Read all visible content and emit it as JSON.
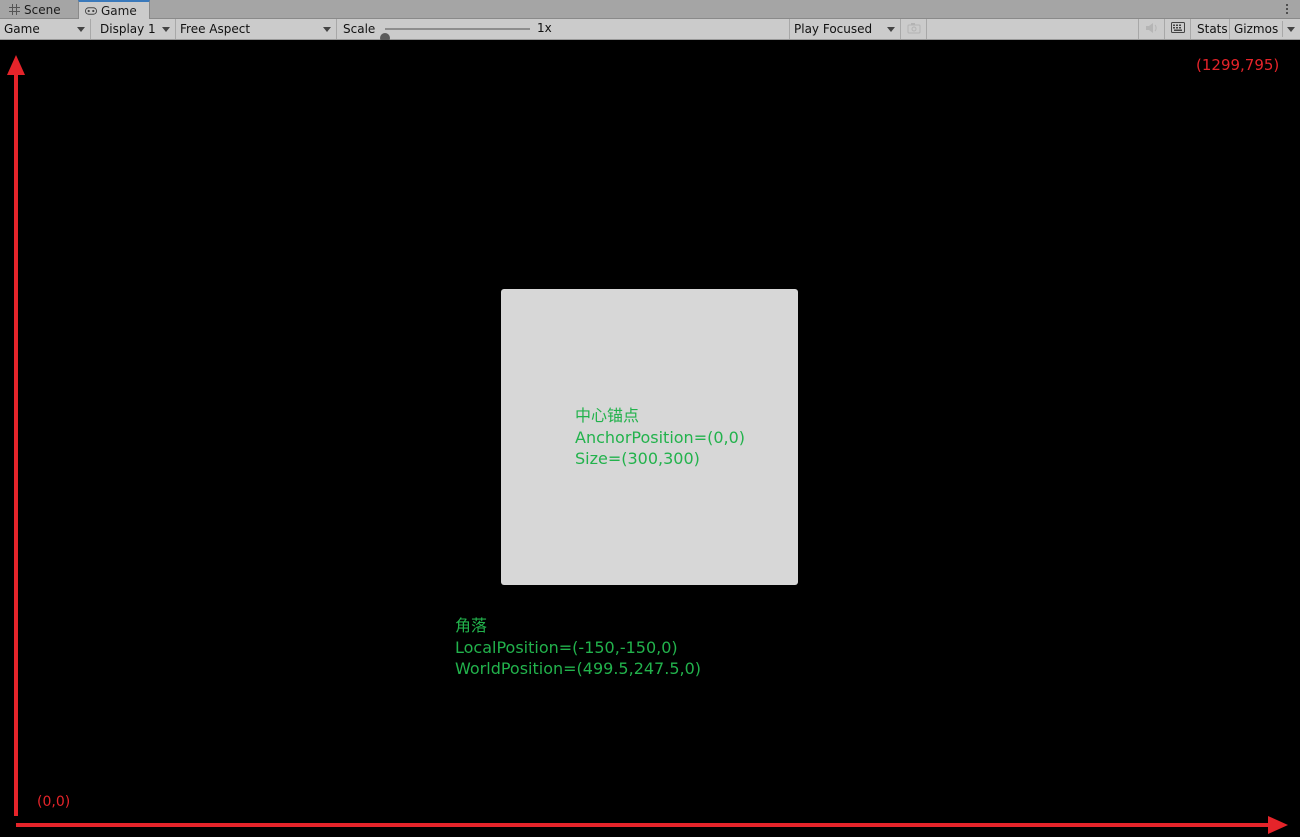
{
  "tabs": [
    {
      "label": "Scene",
      "icon": "grid-icon",
      "active": false
    },
    {
      "label": "Game",
      "icon": "gamepad-icon",
      "active": true
    }
  ],
  "toolbar": {
    "game_dropdown": "Game",
    "display_dropdown": "Display 1",
    "aspect_dropdown": "Free Aspect",
    "scale_label": "Scale",
    "scale_value": "1x",
    "scale_slider_level": 0,
    "play_mode_dropdown": "Play Focused",
    "stats_label": "Stats",
    "gizmos_label": "Gizmos"
  },
  "game_view": {
    "center_anchor": {
      "line1": "中心锚点",
      "line2": "AnchorPosition=(0,0)",
      "line3": "Size=(300,300)"
    },
    "corner": {
      "line1": "角落",
      "line2": "LocalPosition=(-150,-150,0)",
      "line3": "WorldPosition=(499.5,247.5,0)"
    },
    "top_right_coord": "(1299,795)",
    "origin_coord": "(0,0)"
  },
  "colors": {
    "background": "#000000",
    "panel": "#d7d7d7",
    "annotation_green": "#22b24c",
    "annotation_red": "#e5242a",
    "active_tab_accent": "#3a79bb"
  }
}
